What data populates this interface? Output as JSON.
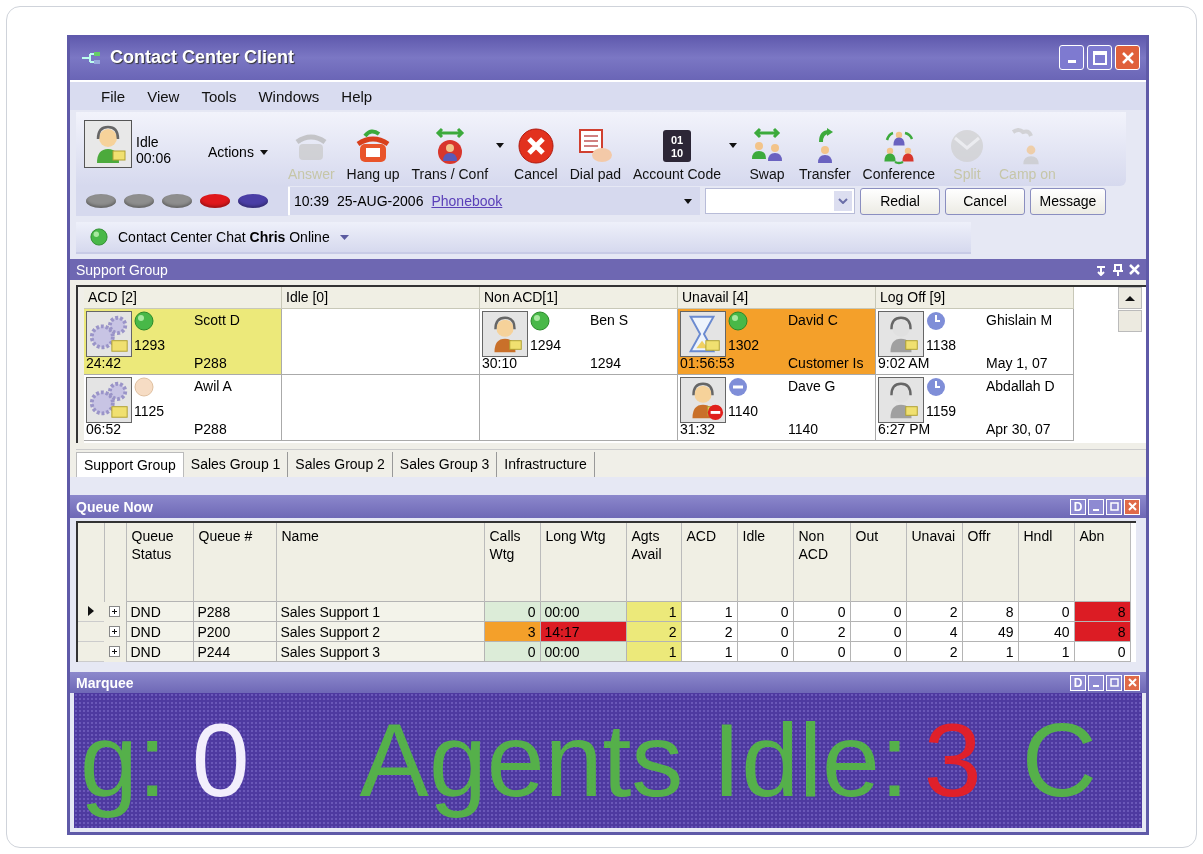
{
  "window": {
    "title": "Contact Center Client"
  },
  "menu": [
    "File",
    "View",
    "Tools",
    "Windows",
    "Help"
  ],
  "agent_status": {
    "state": "Idle",
    "time": "00:06"
  },
  "actions_menu": {
    "label": "Actions"
  },
  "toolbar": [
    {
      "label": "Answer",
      "kind": "answer",
      "disabled": true,
      "dropdown": false
    },
    {
      "label": "Hang up",
      "kind": "hangup",
      "disabled": false,
      "dropdown": false
    },
    {
      "label": "Trans / Conf",
      "kind": "transconf",
      "disabled": false,
      "dropdown": true
    },
    {
      "label": "Cancel",
      "kind": "cancel",
      "disabled": false,
      "dropdown": false
    },
    {
      "label": "Dial pad",
      "kind": "dialpad",
      "disabled": false,
      "dropdown": false
    },
    {
      "label": "Account Code",
      "kind": "code",
      "icon_text": [
        "01",
        "10"
      ],
      "disabled": false,
      "dropdown": true
    },
    {
      "label": "Swap",
      "kind": "swap",
      "disabled": false,
      "dropdown": false
    },
    {
      "label": "Transfer",
      "kind": "transfer",
      "disabled": false,
      "dropdown": false
    },
    {
      "label": "Conference",
      "kind": "conference",
      "disabled": false,
      "dropdown": false
    },
    {
      "label": "Split",
      "kind": "split",
      "disabled": true,
      "dropdown": false
    },
    {
      "label": "Camp on",
      "kind": "campon",
      "disabled": true,
      "dropdown": false
    }
  ],
  "lines": [
    {
      "color": "#8e8e8e"
    },
    {
      "color": "#8e8e8e"
    },
    {
      "color": "#8e8e8e"
    },
    {
      "color": "#e0181c"
    },
    {
      "color": "#4a3ea6"
    }
  ],
  "call_info": {
    "time": "10:39",
    "date": "25-AUG-2006",
    "link": "Phonebook"
  },
  "call_buttons": [
    "Redial",
    "Cancel",
    "Message"
  ],
  "chat": {
    "text": "Contact Center Chat **Chris** Online"
  },
  "support_group": {
    "title": "Support Group",
    "columns": [
      {
        "title": "ACD [2]",
        "cells": [
          {
            "kind": "acd",
            "dot": {
              "kind": "online"
            },
            "ext": "1293",
            "name": "Scott D",
            "time": "24:42",
            "info": "P288",
            "color": "#ece97a"
          },
          {
            "kind": "acd",
            "dot": {
              "kind": "idle"
            },
            "ext": "1125",
            "name": "Awil A",
            "time": "06:52",
            "info": "P288",
            "color": "#ffffff"
          }
        ]
      },
      {
        "title": "Idle [0]"
      },
      {
        "title": "Non ACD[1]",
        "cells": [
          {
            "kind": "talk",
            "dot": {
              "kind": "online"
            },
            "ext": "1294",
            "name": "Ben S",
            "time": "30:10",
            "info": "1294",
            "color": "#ffffff"
          }
        ]
      },
      {
        "title": "Unavail [4]",
        "cells": [
          {
            "kind": "wait",
            "dot": {
              "kind": "online"
            },
            "ext": "1302",
            "name": "David C",
            "time": "01:56:53",
            "info": "Customer Is",
            "color": "#f4a02a"
          },
          {
            "kind": "dnd",
            "dot": {
              "kind": "busy"
            },
            "ext": "1140",
            "name": "Dave G",
            "time": "31:32",
            "info": "1140",
            "color": "#ffffff"
          }
        ]
      },
      {
        "title": "Log Off [9]",
        "cells": [
          {
            "kind": "logoff",
            "dot": {
              "kind": "away"
            },
            "ext": "1138",
            "name": "Ghislain M",
            "time": "9:02 AM",
            "info": "May 1, 07",
            "color": "#ffffff"
          },
          {
            "kind": "logoff",
            "dot": {
              "kind": "away"
            },
            "ext": "1159",
            "name": "Abdallah D",
            "time": "6:27 PM",
            "info": "Apr 30, 07",
            "color": "#ffffff"
          }
        ]
      }
    ],
    "tabs": [
      {
        "label": "Support Group",
        "selected": true
      },
      {
        "label": "Sales Group 1",
        "selected": false
      },
      {
        "label": "Sales Group 2",
        "selected": false
      },
      {
        "label": "Sales Group 3",
        "selected": false
      },
      {
        "label": "Infrastructure",
        "selected": false
      }
    ]
  },
  "queue_now": {
    "title": "Queue Now",
    "panel_button": "D",
    "columns": [
      "Queue Status",
      "Queue #",
      "Name",
      "Calls Wtg",
      "Long Wtg",
      "Agts Avail",
      "ACD",
      "Idle",
      "Non ACD",
      "Out",
      "Unavai",
      "Offr",
      "Hndl",
      "Abn"
    ],
    "rows": [
      {
        "current": true,
        "expanded": false,
        "cells": [
          {
            "text": "DND"
          },
          {
            "text": "P288"
          },
          {
            "text": "Sales Support 1"
          },
          {
            "text": "0",
            "color": "#dcecd8"
          },
          {
            "text": "00:00",
            "color": "#dcecd8"
          },
          {
            "text": "1",
            "color": "#ece97a"
          },
          {
            "text": "1"
          },
          {
            "text": "0"
          },
          {
            "text": "0"
          },
          {
            "text": "0"
          },
          {
            "text": "2"
          },
          {
            "text": "8"
          },
          {
            "text": "0"
          },
          {
            "text": "8",
            "color": "#dc1c24"
          }
        ]
      },
      {
        "current": false,
        "expanded": false,
        "cells": [
          {
            "text": "DND"
          },
          {
            "text": "P200"
          },
          {
            "text": "Sales Support 2"
          },
          {
            "text": "3",
            "color": "#f4a02a"
          },
          {
            "text": "14:17",
            "color": "#dc1c24"
          },
          {
            "text": "2",
            "color": "#ece97a"
          },
          {
            "text": "2"
          },
          {
            "text": "0"
          },
          {
            "text": "2"
          },
          {
            "text": "0"
          },
          {
            "text": "4"
          },
          {
            "text": "49"
          },
          {
            "text": "40"
          },
          {
            "text": "8",
            "color": "#dc1c24"
          }
        ]
      },
      {
        "current": false,
        "expanded": false,
        "cells": [
          {
            "text": "DND"
          },
          {
            "text": "P244"
          },
          {
            "text": "Sales Support 3"
          },
          {
            "text": "0",
            "color": "#dcecd8"
          },
          {
            "text": "00:00",
            "color": "#dcecd8"
          },
          {
            "text": "1",
            "color": "#ece97a"
          },
          {
            "text": "1"
          },
          {
            "text": "0"
          },
          {
            "text": "0"
          },
          {
            "text": "0"
          },
          {
            "text": "2"
          },
          {
            "text": "1"
          },
          {
            "text": "1"
          },
          {
            "text": "0"
          }
        ]
      }
    ]
  },
  "marquee": {
    "title": "Marquee",
    "panel_button": "D",
    "segments": [
      {
        "text": "g:",
        "color": "#55b04a"
      },
      {
        "text": "0",
        "color": "#f2eefc"
      },
      {
        "text": "Agents Idle:",
        "color": "#55b04a"
      },
      {
        "text": "3",
        "color": "#e0202a"
      },
      {
        "text": "C",
        "color": "#55b04a"
      }
    ]
  }
}
